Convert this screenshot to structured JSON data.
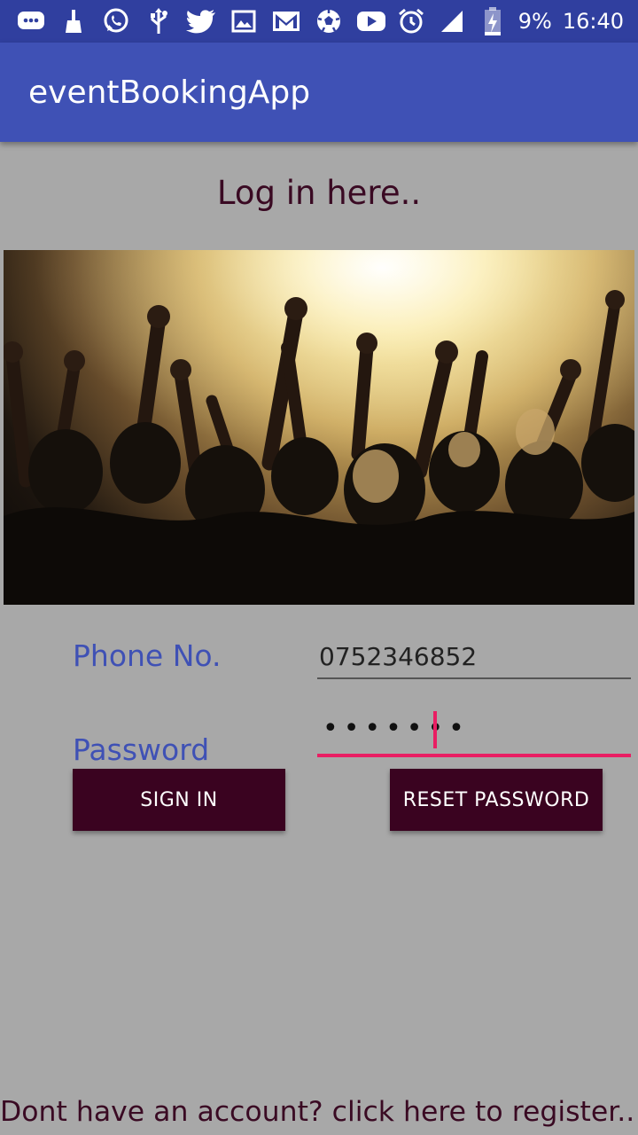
{
  "status_bar": {
    "battery": "9%",
    "time": "16:40",
    "icons_left": [
      "chat-bubble-icon",
      "broom-icon",
      "whatsapp-icon",
      "usb-icon",
      "twitter-icon",
      "image-icon",
      "gmail-icon",
      "soccer-ball-icon",
      "youtube-icon"
    ],
    "icons_right": [
      "alarm-icon",
      "signal-icon",
      "battery-charging-icon"
    ],
    "background": "#303f9f"
  },
  "app_bar": {
    "title": "eventBookingApp",
    "background": "#3f51b5"
  },
  "heading": "Log in here..",
  "hero_image": {
    "subject": "concert crowd with raised hands under stage lights"
  },
  "form": {
    "phone_label": "Phone No.",
    "phone_value": "0752346852",
    "password_label": "Password",
    "password_mask": "•••••••"
  },
  "buttons": {
    "sign_in": "SIGN IN",
    "reset_password": "RESET PASSWORD",
    "color": "#3a0320"
  },
  "register_link": "Dont have an account? click here to register..",
  "colors": {
    "background": "#a8a8a8",
    "label_text": "#3f51b5",
    "accent": "#e91e63",
    "heading_text": "#3a0a23"
  }
}
